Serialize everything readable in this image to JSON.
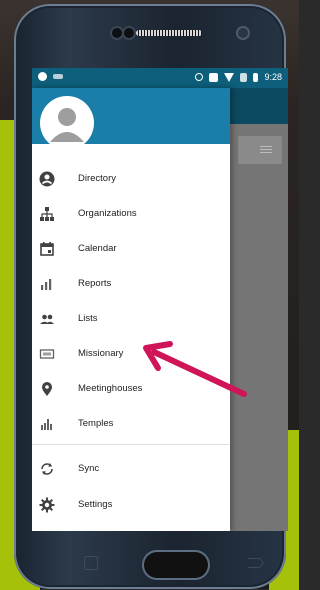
{
  "status_bar": {
    "time": "9:28"
  },
  "drawer": {
    "items": [
      {
        "label": "Directory",
        "icon": "person-circle-icon"
      },
      {
        "label": "Organizations",
        "icon": "org-tree-icon"
      },
      {
        "label": "Calendar",
        "icon": "calendar-icon"
      },
      {
        "label": "Reports",
        "icon": "bar-chart-icon"
      },
      {
        "label": "Lists",
        "icon": "people-icon"
      },
      {
        "label": "Missionary",
        "icon": "badge-card-icon"
      },
      {
        "label": "Meetinghouses",
        "icon": "location-pin-icon"
      },
      {
        "label": "Temples",
        "icon": "temple-icon"
      },
      {
        "label": "Sync",
        "icon": "sync-icon"
      },
      {
        "label": "Settings",
        "icon": "gear-icon"
      }
    ]
  },
  "colors": {
    "status_bar": "#0e5f7c",
    "drawer_header": "#1a7ea8",
    "arrow": "#d0145a",
    "background_accent": "#a6c10a"
  }
}
